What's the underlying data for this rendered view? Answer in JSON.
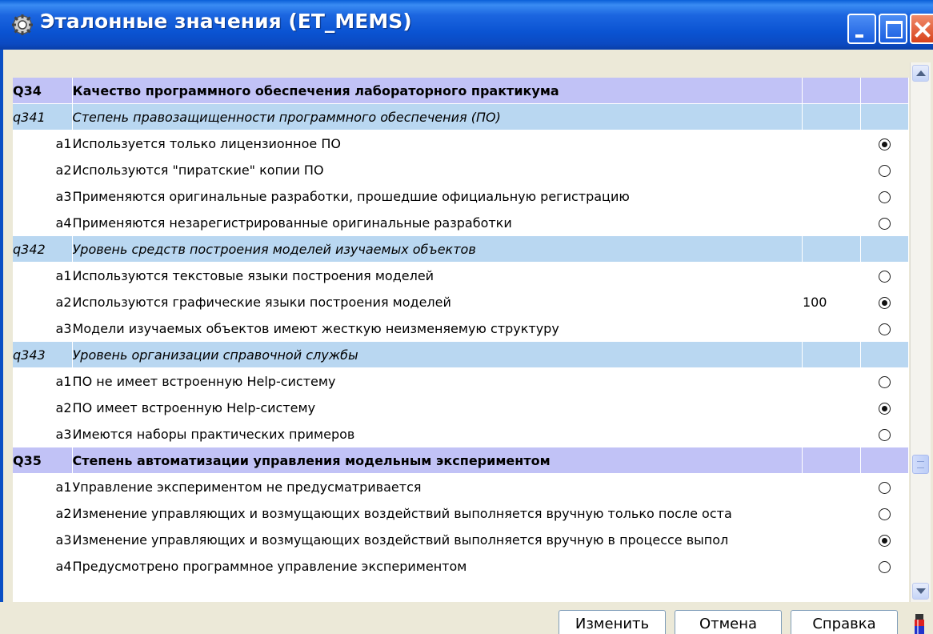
{
  "window": {
    "title": "Эталонные значения (ET_MEMS)",
    "icon": "gear-icon",
    "controls": [
      "minimize-icon",
      "maximize-icon",
      "close-icon"
    ]
  },
  "grid": {
    "rows": [
      {
        "kind": "cat",
        "code": "Q34",
        "text": "Качество программного обеспечения лабораторного практикума",
        "value": "",
        "selected": null
      },
      {
        "kind": "sub",
        "code": "q341",
        "text": "Степень правозащищенности программного обеспечения (ПО)",
        "value": "",
        "selected": null
      },
      {
        "kind": "ans",
        "code": "a1",
        "text": "Используется только лицензионное ПО",
        "value": "",
        "selected": true
      },
      {
        "kind": "ans",
        "code": "a2",
        "text": "Используются \"пиратские\" копии ПО",
        "value": "",
        "selected": false
      },
      {
        "kind": "ans",
        "code": "a3",
        "text": "Применяются оригинальные разработки, прошедшие официальную регистрацию",
        "value": "",
        "selected": false
      },
      {
        "kind": "ans",
        "code": "a4",
        "text": "Применяются незарегистрированные оригинальные разработки",
        "value": "",
        "selected": false
      },
      {
        "kind": "sub",
        "code": "q342",
        "text": "Уровень средств построения моделей изучаемых объектов",
        "value": "",
        "selected": null
      },
      {
        "kind": "ans",
        "code": "a1",
        "text": "Используются текстовые языки построения моделей",
        "value": "",
        "selected": false
      },
      {
        "kind": "ans",
        "code": "a2",
        "text": "Используются графические языки построения моделей",
        "value": "100",
        "selected": true
      },
      {
        "kind": "ans",
        "code": "a3",
        "text": "Модели изучаемых объектов имеют жесткую неизменяемую структуру",
        "value": "",
        "selected": false
      },
      {
        "kind": "sub",
        "code": "q343",
        "text": "Уровень организации справочной службы",
        "value": "",
        "selected": null
      },
      {
        "kind": "ans",
        "code": "a1",
        "text": "ПО не имеет встроенную Help-систему",
        "value": "",
        "selected": false
      },
      {
        "kind": "ans",
        "code": "a2",
        "text": "ПО имеет встроенную Help-систему",
        "value": "",
        "selected": true
      },
      {
        "kind": "ans",
        "code": "a3",
        "text": "Имеются наборы практических примеров",
        "value": "",
        "selected": false
      },
      {
        "kind": "cat",
        "code": "Q35",
        "text": "Степень автоматизации управления модельным экспериментом",
        "value": "",
        "selected": null
      },
      {
        "kind": "ans",
        "code": "a1",
        "text": "Управление экспериментом не предусматривается",
        "value": "",
        "selected": false
      },
      {
        "kind": "ans",
        "code": "a2",
        "text": "Изменение управляющих и возмущающих воздействий выполняется вручную только после оста",
        "value": "",
        "selected": false
      },
      {
        "kind": "ans",
        "code": "a3",
        "text": "Изменение управляющих и возмущающих воздействий выполняется вручную в процессе выпол",
        "value": "",
        "selected": true
      },
      {
        "kind": "ans",
        "code": "a4",
        "text": "Предусмотрено программное управление экспериментом",
        "value": "",
        "selected": false
      }
    ]
  },
  "footer": {
    "change_label": "Изменить",
    "cancel_label": "Отмена",
    "help_label": "Справка",
    "extra_icon": "paint-icon"
  }
}
